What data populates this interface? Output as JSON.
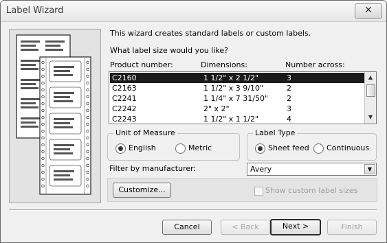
{
  "window": {
    "title": "Label Wizard",
    "close_glyph": "✕"
  },
  "intro": "This wizard creates standard labels or custom labels.",
  "question": "What label size would you like?",
  "columns": {
    "product": "Product number:",
    "dimensions": "Dimensions:",
    "across": "Number across:"
  },
  "rows": [
    {
      "product": "C2160",
      "dimensions": "1 1/2\" x 2 1/2\"",
      "across": "3",
      "selected": true
    },
    {
      "product": "C2163",
      "dimensions": "1 1/2\" x 3 9/10\"",
      "across": "2",
      "selected": false
    },
    {
      "product": "C2241",
      "dimensions": "1 1/4\" x 7 31/50\"",
      "across": "2",
      "selected": false
    },
    {
      "product": "C2242",
      "dimensions": "2\" x 2\"",
      "across": "3",
      "selected": false
    },
    {
      "product": "C2243",
      "dimensions": "1 1/2\" x 1 1/2\"",
      "across": "4",
      "selected": false
    }
  ],
  "unit_of_measure": {
    "legend": "Unit of Measure",
    "english": "English",
    "metric": "Metric",
    "selected": "English"
  },
  "label_type": {
    "legend": "Label Type",
    "sheet_feed": "Sheet feed",
    "continuous": "Continuous",
    "selected": "Sheet feed"
  },
  "filter": {
    "label": "Filter by  manufacturer:",
    "value": "Avery"
  },
  "customize_button": "Customize...",
  "show_custom_label": "Show custom label sizes",
  "buttons": {
    "cancel": "Cancel",
    "back": "< Back",
    "next": "Next >",
    "finish": "Finish"
  },
  "icons": {
    "illustration": "label-sheets-illustration-icon",
    "scroll_up": "scroll-up-icon",
    "scroll_down": "scroll-down-icon",
    "dropdown": "chevron-down-icon"
  }
}
